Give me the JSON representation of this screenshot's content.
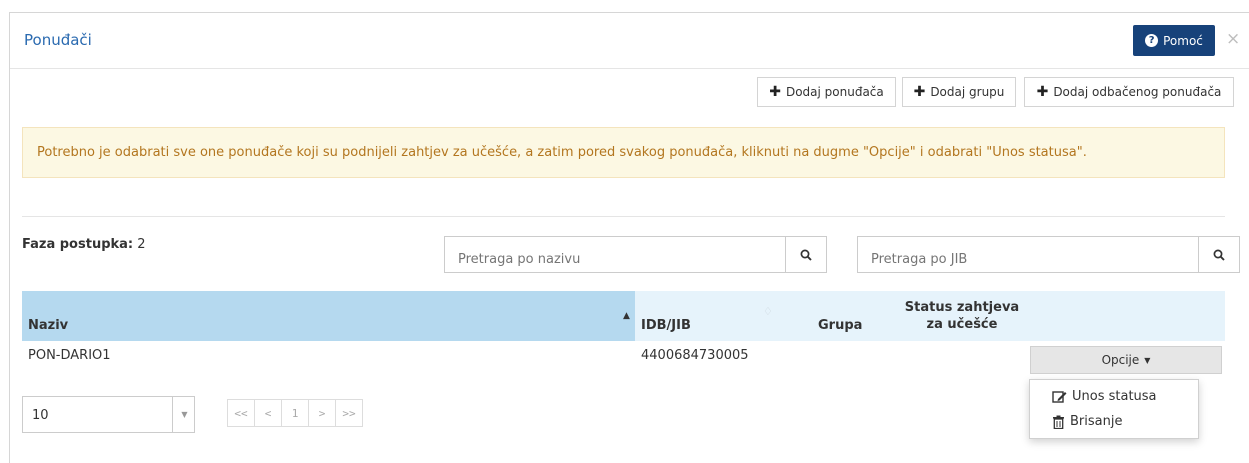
{
  "header": {
    "title": "Ponuđači",
    "help_label": "Pomoć",
    "close_glyph": "×"
  },
  "toolbar": {
    "add_bidder": "Dodaj ponuđača",
    "add_group": "Dodaj grupu",
    "add_rejected": "Dodaj odbačenog ponuđača"
  },
  "alert": {
    "text": "Potrebno je odabrati sve one ponuđače koji su podnijeli zahtjev za učešće, a zatim pored svakog ponuđača, kliknuti na dugme \"Opcije\" i odabrati \"Unos statusa\"."
  },
  "phase": {
    "label": "Faza postupka:",
    "value": "2"
  },
  "search": {
    "name_placeholder": "Pretraga po nazivu",
    "jib_placeholder": "Pretraga po JIB"
  },
  "table": {
    "columns": {
      "naziv": "Naziv",
      "idb": "IDB/JIB",
      "grupa": "Grupa",
      "status_line1": "Status zahtjeva",
      "status_line2": "za učešće"
    },
    "rows": [
      {
        "naziv": "PON-DARIO1",
        "idb": "4400684730005",
        "grupa": "",
        "status": ""
      }
    ]
  },
  "actions": {
    "options_label": "Opcije",
    "menu": [
      {
        "label": "Unos statusa",
        "icon": "edit-icon"
      },
      {
        "label": "Brisanje",
        "icon": "trash-icon"
      }
    ]
  },
  "pagination": {
    "page_size": "10",
    "first": "<<",
    "prev": "<",
    "current": "1",
    "next": ">",
    "last": ">>"
  }
}
